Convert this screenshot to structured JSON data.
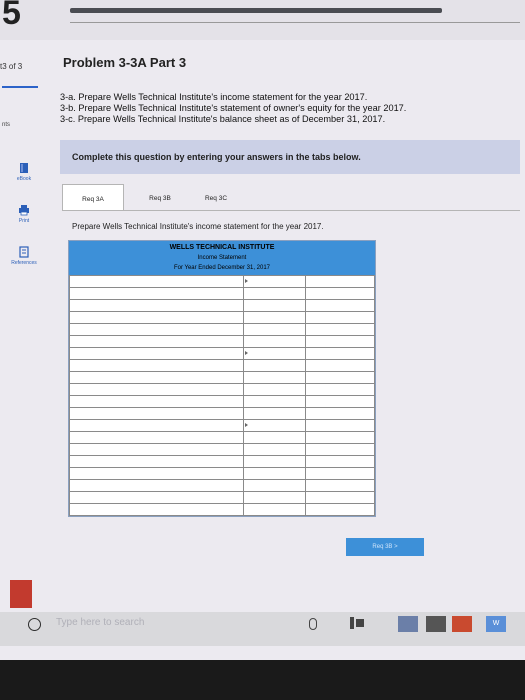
{
  "header": {
    "question_number": "5"
  },
  "sidebar": {
    "question_counter": "t3 of 3",
    "points_label": "nts",
    "ebook_label": "eBook",
    "print_label": "Print",
    "references_label": "References"
  },
  "problem": {
    "title": "Problem 3-3A Part 3",
    "instructions": [
      "3-a. Prepare Wells Technical Institute's income statement for the year 2017.",
      "3-b. Prepare Wells Technical Institute's statement of owner's equity for the year 2017.",
      "3-c. Prepare Wells Technical Institute's balance sheet as of December 31, 2017."
    ]
  },
  "banner": {
    "text": "Complete this question by entering your answers in the tabs below."
  },
  "tabs": [
    {
      "label": "Req 3A",
      "active": true
    },
    {
      "label": "Req 3B",
      "active": false
    },
    {
      "label": "Req 3C",
      "active": false
    }
  ],
  "req_text": "Prepare Wells Technical Institute's income statement for the year 2017.",
  "statement": {
    "company": "WELLS TECHNICAL INSTITUTE",
    "title": "Income Statement",
    "period": "For Year Ended December 31, 2017",
    "rows": 20
  },
  "next_button": {
    "label": "Req 3B  >"
  },
  "taskbar": {
    "search_placeholder": "Type here to search",
    "word_label": "W"
  }
}
